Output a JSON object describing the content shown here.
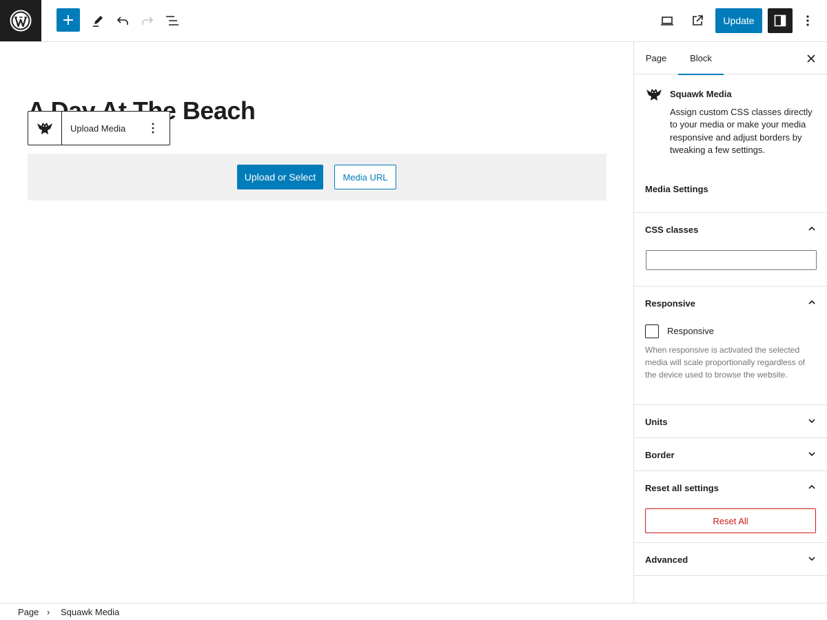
{
  "header": {
    "update_label": "Update"
  },
  "editor": {
    "page_title": "A Day At The Beach",
    "block_toolbar": {
      "label": "Upload Media"
    },
    "placeholder": {
      "primary_label": "Upload or Select",
      "secondary_label": "Media URL"
    }
  },
  "sidebar": {
    "tabs": [
      {
        "label": "Page"
      },
      {
        "label": "Block"
      }
    ],
    "block": {
      "title": "Squawk Media",
      "description": "Assign custom CSS classes directly to your media or make your media responsive and adjust borders by tweaking a few settings.",
      "settings_heading": "Media Settings"
    },
    "panels": {
      "css": {
        "title": "CSS classes",
        "input_value": ""
      },
      "responsive": {
        "title": "Responsive",
        "checkbox_label": "Responsive",
        "checked": false,
        "help": "When responsive is activated the selected media will scale proportionally regardless of the device used to browse the website."
      },
      "units": {
        "title": "Units"
      },
      "border": {
        "title": "Border"
      },
      "reset": {
        "title": "Reset all settings",
        "button_label": "Reset All"
      },
      "advanced": {
        "title": "Advanced"
      }
    }
  },
  "breadcrumb": {
    "items": [
      "Page",
      "Squawk Media"
    ]
  },
  "colors": {
    "accent": "#007cba",
    "dark": "#1e1e1e",
    "danger": "#cc1818",
    "placeholder_bg": "#f0f0f0"
  }
}
